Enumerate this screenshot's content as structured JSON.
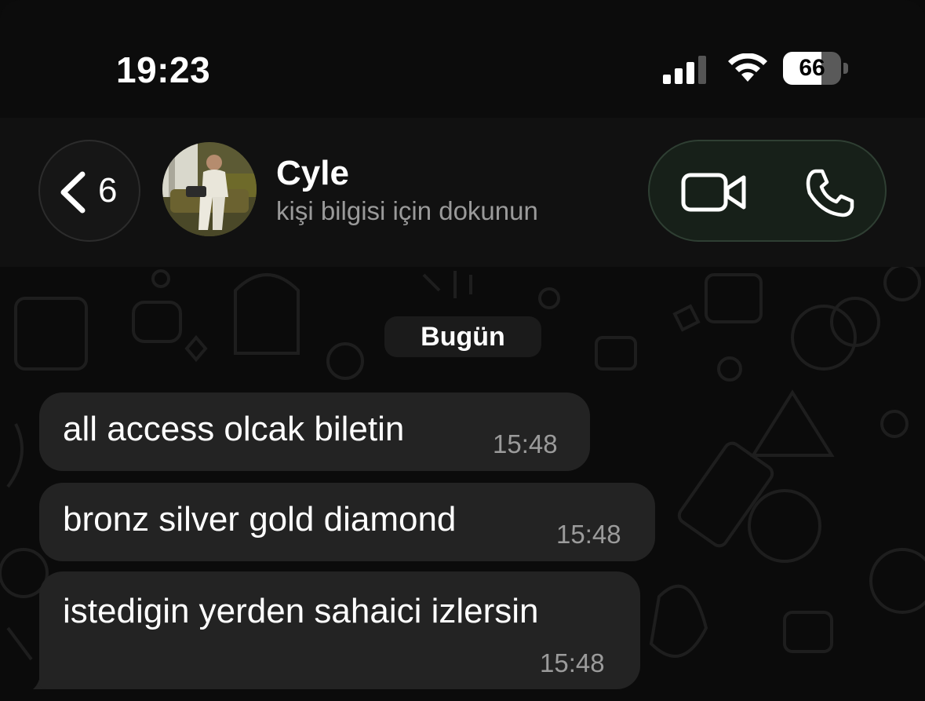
{
  "status_bar": {
    "time": "19:23",
    "battery": "66",
    "battery_level": 0.66
  },
  "header": {
    "back_count": "6",
    "contact_name": "Cyle",
    "contact_subtitle": "kişi bilgisi için dokunun"
  },
  "chat": {
    "date_label": "Bugün",
    "messages": [
      {
        "text": "all access olcak biletin",
        "time": "15:48"
      },
      {
        "text": "bronz silver gold diamond",
        "time": "15:48"
      },
      {
        "text": "istedigin yerden sahaici izlersin",
        "time": "15:48"
      }
    ]
  },
  "colors": {
    "background": "#0b0b0b",
    "bubble": "#232323",
    "call_pill": "#172019",
    "subtitle": "#9a9a9a"
  },
  "icons": [
    "chevron-left-icon",
    "video-camera-icon",
    "phone-icon",
    "signal-icon",
    "wifi-icon",
    "battery-icon"
  ]
}
